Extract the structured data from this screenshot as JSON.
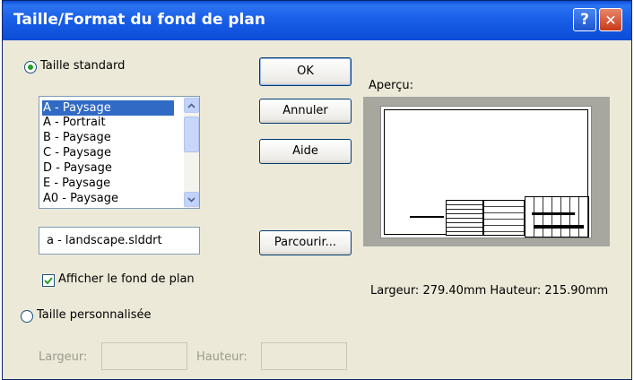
{
  "window": {
    "title": "Taille/Format du fond de plan",
    "help_glyph": "?",
    "close_glyph": "✕"
  },
  "standard": {
    "radio_label": "Taille standard",
    "selected": true,
    "sizes": [
      "A - Paysage",
      "A - Portrait",
      "B - Paysage",
      "C - Paysage",
      "D - Paysage",
      "E - Paysage",
      "A0 - Paysage"
    ],
    "selected_index": 0,
    "template_file": "a - landscape.slddrt",
    "show_format_label": "Afficher le fond de plan",
    "show_format_checked": true
  },
  "custom": {
    "radio_label": "Taille personnalisée",
    "selected": false,
    "width_label": "Largeur:",
    "height_label": "Hauteur:",
    "width_value": "",
    "height_value": ""
  },
  "buttons": {
    "ok": "OK",
    "cancel": "Annuler",
    "help": "Aide",
    "browse": "Parcourir..."
  },
  "preview": {
    "label": "Aperçu:",
    "dimensions": "Largeur: 279.40mm  Hauteur: 215.90mm"
  },
  "icons": {
    "help": "help-icon",
    "close": "close-icon",
    "scroll_up": "chevron-up-icon",
    "scroll_down": "chevron-down-icon",
    "check": "checkmark-icon"
  },
  "colors": {
    "titlebar": "#0b4cd6",
    "dialog_bg": "#ece9d8",
    "selection": "#316ac5",
    "radio_dot": "#21a121",
    "close_button": "#c63a18"
  }
}
